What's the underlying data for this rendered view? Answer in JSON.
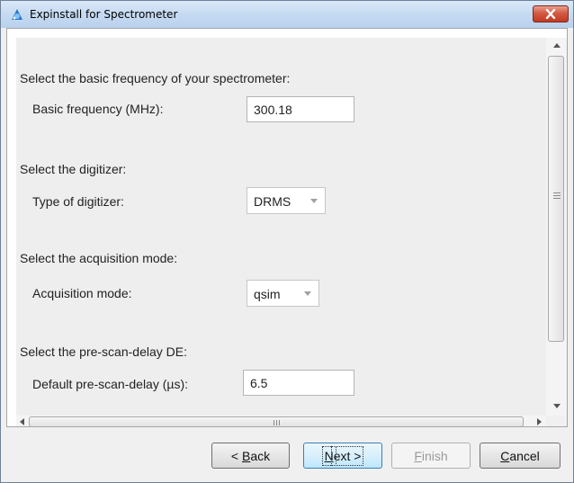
{
  "window": {
    "title": "Expinstall for Spectrometer"
  },
  "form": {
    "frequency_section": "Select the basic frequency of your spectrometer:",
    "frequency_label": "Basic frequency (MHz):",
    "frequency_value": "300.18",
    "digitizer_section": "Select the digitizer:",
    "digitizer_label": "Type of digitizer:",
    "digitizer_value": "DRMS",
    "acq_section": "Select the acquisition mode:",
    "acq_label": "Acquisition mode:",
    "acq_value": "qsim",
    "delay_section": "Select the pre-scan-delay DE:",
    "delay_label": "Default pre-scan-delay (µs):",
    "delay_value": "6.5"
  },
  "buttons": {
    "back_prefix": "< ",
    "back_mnemonic": "B",
    "back_rest": "ack",
    "next_mnemonic": "N",
    "next_rest": "ext >",
    "finish_mnemonic": "F",
    "finish_rest": "inish",
    "cancel_mnemonic": "C",
    "cancel_rest": "ancel"
  },
  "icons": {
    "app": "app-icon",
    "close": "close-icon",
    "scroll_up": "up-arrow-icon",
    "scroll_down": "down-arrow-icon",
    "scroll_left": "left-arrow-icon",
    "scroll_right": "right-arrow-icon",
    "dropdown": "chevron-down-icon"
  },
  "colors": {
    "title_bar": "#c7dbf2",
    "close_button": "#c23a22",
    "panel": "#eeeeee",
    "default_button": "#bee6fd"
  }
}
